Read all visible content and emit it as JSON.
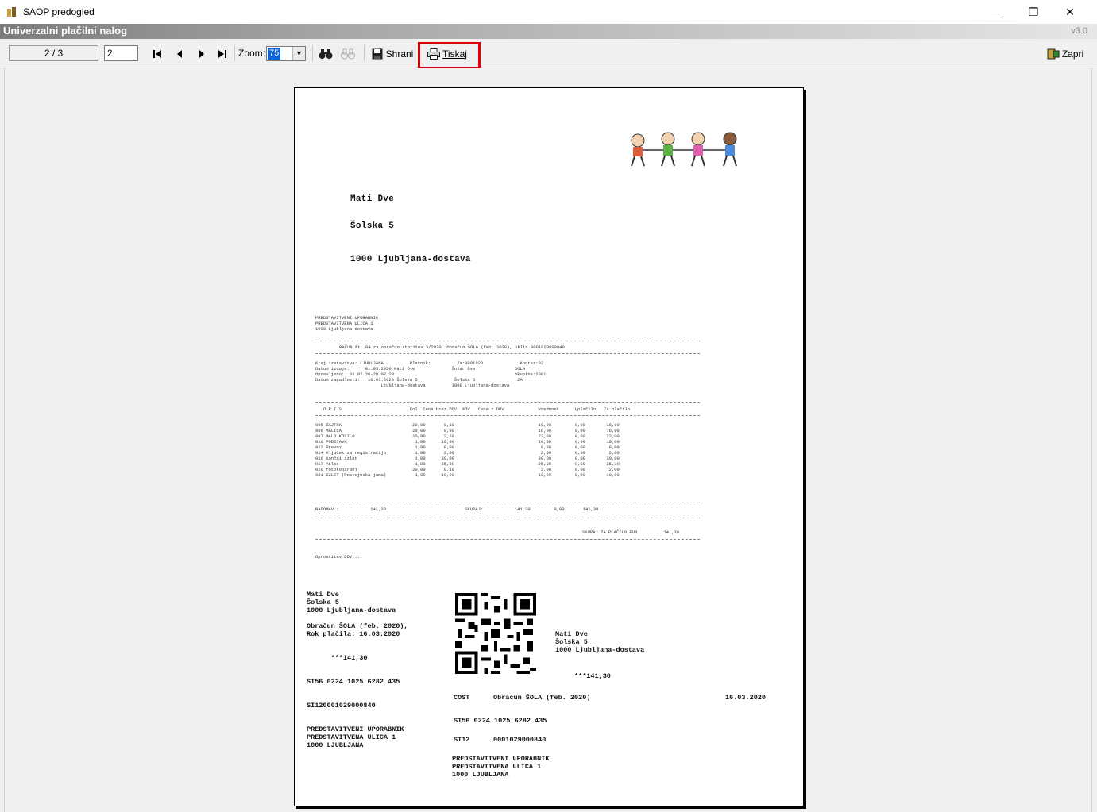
{
  "window": {
    "title": "SAOP predogled",
    "min": "—",
    "restore": "❐",
    "close": "✕"
  },
  "caption": {
    "title": "Univerzalni plačilni nalog",
    "version": "v3.0"
  },
  "toolbar": {
    "page_status": "2 / 3",
    "page_input": "2",
    "zoom_label": "Zoom:",
    "zoom_value": "75",
    "save_label": "Shrani",
    "print_label": "Tiskaj",
    "close_label": "Zapri"
  },
  "document": {
    "recipient": {
      "name": "Mati Dve",
      "street": "Šolska 5",
      "city": "1000 Ljubljana-dostava"
    },
    "issuer_lines": "PREDSTAVITVENI UPORABNIK\nPREDSTAVITVENA ULICA 1\n1000 Ljubljana-dostava",
    "invoice_title": "RAČUN št. 84 za obračun storitev 3/2020  Obračun ŠOLA (feb. 2020), sklic 0001029000840",
    "info_block": "Kraj izstavitve: LJUBLJANA          Plačnik:          Za:0001029              Knotez:02\nDatum izdaje:      01.03.2020 Mati Dve              Šolar Dve               ŠOLA\nOpravljeno:  01.02.20-29.02.20                                              Skupina:2001\nDatum zapadlosti:   16.03.2020 Šolska 5              Šolska 5                2A\n                         Ljubljana-dostava          1000 Ljubljana-dostava",
    "table_header": "   O P I S                          Kol. Cena brez DDV  %DV   Cena z DDV             Vrednost      Uplačilo   Za plačilo",
    "table_rows": "005 ZAJTRK                           20,00       0,80                                16,00         0,00        16,00\n006 MALICA                           20,00       0,80                                16,00         0,00        16,00\n007 MALO KOSILO                      10,00       2,20                                22,00         0,00        22,00\n010 PODSTAVA                          1,00      10,00                                10,00         0,00        10,00\n013 Prevoz                            1,00       8,00                                 8,00         0,00         8,00\n014 Ključek za registracijo           1,00       2,00                                 2,00         0,00         2,00\n016 Končni izlet                      1,00      30,00                                30,00         0,00        30,00\n017 Atlas                             1,00      25,30                                25,30         0,00        25,30\n020 fotokopiranj                     20,00       0,10                                 2,00         0,00         2,00\n021 IZLET (Postojnska jama)           1,00      10,00                                10,00         0,00        10,00",
    "nadomest": "NADOMAV.:            141,30                              SKUPAJ:            141,30         0,00       141,30",
    "total_line": "SKUPAJ ZA PLAČILO EUR          141,30",
    "vat_note": "Oprostitev DDV....",
    "slip_left": "Mati Dve\nŠolska 5\n1000 Ljubljana-dostava\n\nObračun ŠOLA (feb. 2020),\nRok plačila: 16.03.2020\n\n\n      ***141,30\n\n\nSI56 0224 1025 6282 435\n\n\nSI120001029000840\n\n\nPREDSTAVITVENI UPORABNIK\nPREDSTAVITVENA ULICA 1\n1000 LJUBLJANA",
    "slip_right_addr": "Mati Dve\nŠolska 5\n1000 Ljubljana-dostava",
    "slip_right_amount": "***141,30",
    "slip_code": "COST",
    "slip_purpose": "Obračun ŠOLA (feb. 2020)",
    "slip_date": "16.03.2020",
    "slip_iban": "SI56 0224 1025 6282 435",
    "slip_ref_model": "SI12",
    "slip_ref": "0001029000840",
    "slip_payee": "PREDSTAVITVENI UPORABNIK\nPREDSTAVITVENA ULICA 1\n1000 LJUBLJANA"
  }
}
